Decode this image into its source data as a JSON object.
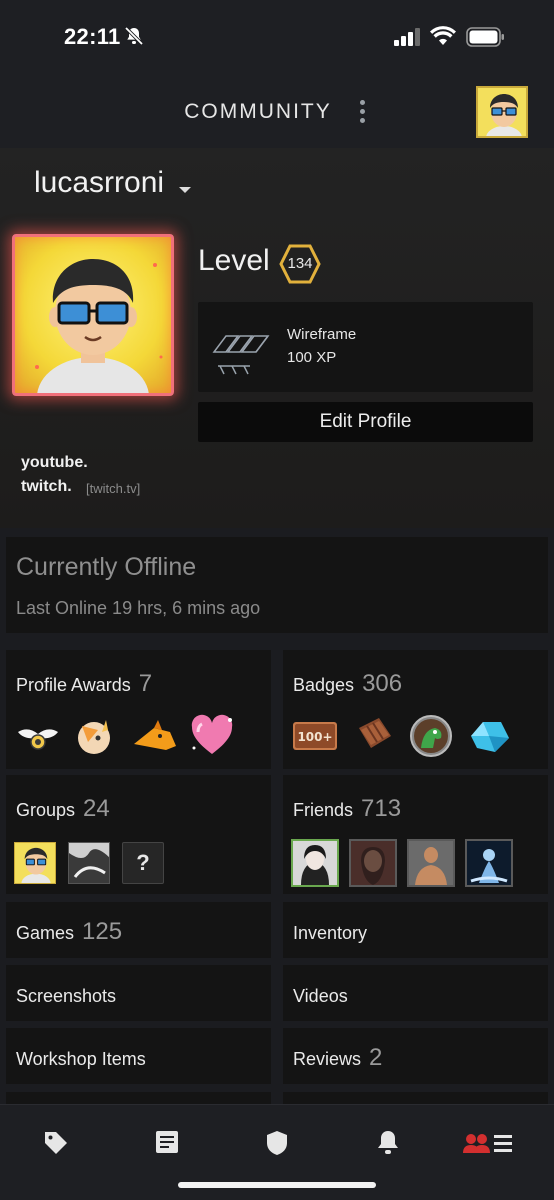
{
  "status_bar": {
    "time": "22:11"
  },
  "header": {
    "title": "COMMUNITY"
  },
  "profile": {
    "username": "lucasrroni",
    "level_label": "Level",
    "level_value": "134",
    "badge": {
      "name": "Wireframe",
      "xp": "100 XP"
    },
    "edit_label": "Edit Profile",
    "links": [
      {
        "label": "youtube.",
        "sub": ""
      },
      {
        "label": "twitch.",
        "sub": "[twitch.tv]"
      }
    ]
  },
  "status": {
    "title": "Currently Offline",
    "last_online": "Last Online 19 hrs, 6 mins ago"
  },
  "sections": {
    "profile_awards": {
      "label": "Profile Awards",
      "count": "7"
    },
    "badges": {
      "label": "Badges",
      "count": "306"
    },
    "groups": {
      "label": "Groups",
      "count": "24"
    },
    "friends": {
      "label": "Friends",
      "count": "713"
    },
    "games": {
      "label": "Games",
      "count": "125"
    },
    "inventory": {
      "label": "Inventory"
    },
    "screenshots": {
      "label": "Screenshots"
    },
    "videos": {
      "label": "Videos"
    },
    "workshop": {
      "label": "Workshop Items"
    },
    "reviews": {
      "label": "Reviews",
      "count": "2"
    }
  },
  "groups_placeholder_glyph": "?",
  "badge_tile_text": "100+",
  "nav": {
    "items": [
      "tag-icon",
      "news-icon",
      "shield-icon",
      "bell-icon",
      "community-friends-icon"
    ],
    "active_color": "#d32f2f"
  },
  "colors": {
    "background": "#1b1c20",
    "card": "#141414",
    "accent_ring": "#f0707a",
    "level_ring": "#e2b13c"
  }
}
